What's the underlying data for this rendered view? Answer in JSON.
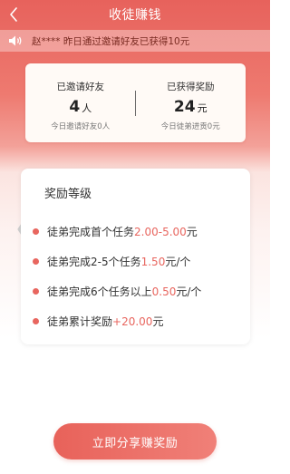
{
  "header": {
    "title": "收徒赚钱"
  },
  "notice": {
    "text": "赵**** 昨日通过邀请好友已获得10元"
  },
  "stats": {
    "invited": {
      "label": "已邀请好友",
      "value": "4",
      "unit": "人",
      "sub": "今日邀请好友0人"
    },
    "reward": {
      "label": "已获得奖励",
      "value": "24",
      "unit": "元",
      "sub": "今日徒弟进贡0元"
    }
  },
  "rewards": {
    "title": "奖励等级",
    "items": [
      {
        "text": "徒弟完成首个任务",
        "highlight": "2.00-5.00",
        "suffix": "元"
      },
      {
        "text": "徒弟完成2-5个任务",
        "highlight": "1.50",
        "suffix": "元/个"
      },
      {
        "text": "徒弟完成6个任务以上",
        "highlight": "0.50",
        "suffix": "元/个"
      },
      {
        "text": "徒弟累计奖励",
        "highlight": "+20.00",
        "suffix": "元"
      }
    ]
  },
  "button": {
    "label": "立即分享赚奖励"
  },
  "colors": {
    "primary": "#e8665f",
    "text": "#333333"
  },
  "icons": {
    "back": "back-chevron-icon",
    "speaker": "speaker-icon",
    "left": "chevron-left-icon",
    "right": "chevron-right-icon"
  }
}
